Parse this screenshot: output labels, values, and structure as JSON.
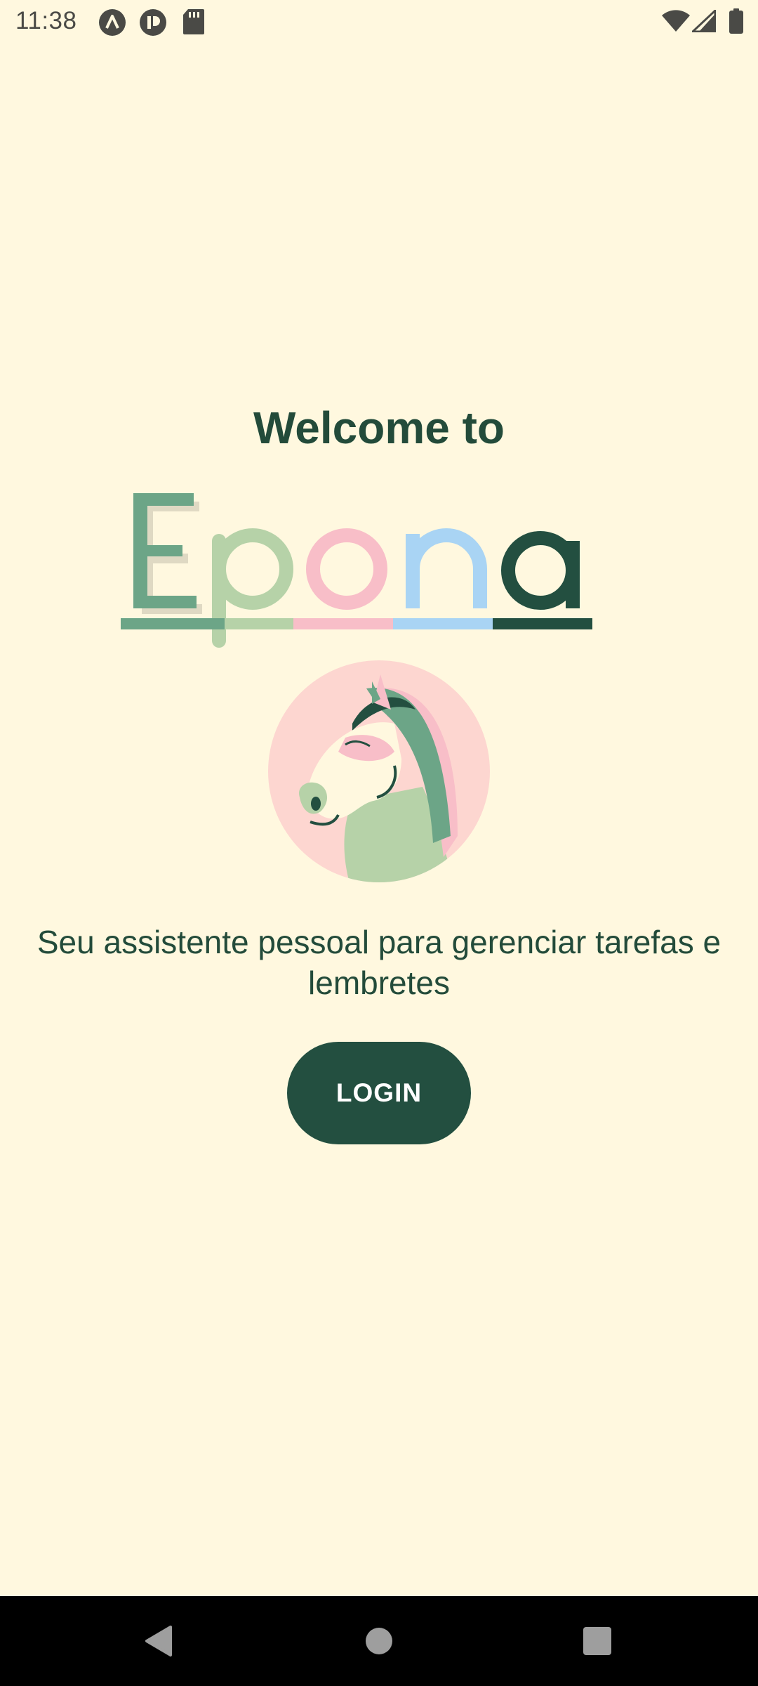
{
  "status_bar": {
    "time": "11:38",
    "left_icons": [
      "notification-a-icon",
      "notification-b-icon",
      "sd-card-icon"
    ],
    "right_icons": [
      "wifi-icon",
      "cell-signal-icon",
      "battery-icon"
    ]
  },
  "main": {
    "welcome_text": "Welcome to",
    "logo_text": "Epona",
    "logo_colors": [
      "#6CA587",
      "#B6D2A8",
      "#F8BEC8",
      "#A9D4F4",
      "#234F40"
    ],
    "tagline": "Seu assistente pessoal para gerenciar tarefas e lembretes",
    "login_label": "LOGIN"
  },
  "nav_bar": {
    "buttons": [
      "back-icon",
      "home-icon",
      "recents-icon"
    ]
  },
  "colors": {
    "background": "#FFF8DF",
    "primary": "#234F40",
    "text": "#234B3A"
  }
}
